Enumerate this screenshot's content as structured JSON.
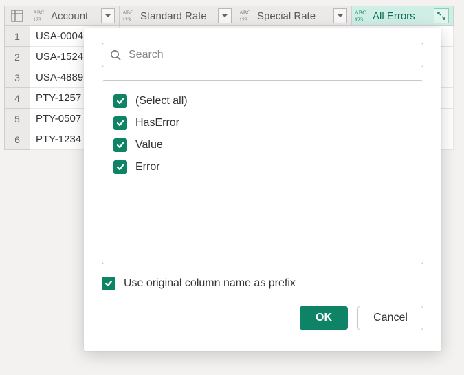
{
  "columns": [
    {
      "label": "Account"
    },
    {
      "label": "Standard Rate"
    },
    {
      "label": "Special Rate"
    },
    {
      "label": "All Errors"
    }
  ],
  "rows": [
    {
      "num": "1",
      "account": "USA-0004"
    },
    {
      "num": "2",
      "account": "USA-1524"
    },
    {
      "num": "3",
      "account": "USA-4889"
    },
    {
      "num": "4",
      "account": "PTY-1257"
    },
    {
      "num": "5",
      "account": "PTY-0507"
    },
    {
      "num": "6",
      "account": "PTY-1234"
    }
  ],
  "panel": {
    "search_placeholder": "Search",
    "options": {
      "select_all": "(Select all)",
      "has_error": "HasError",
      "value": "Value",
      "error": "Error"
    },
    "prefix_label": "Use original column name as prefix",
    "ok_label": "OK",
    "cancel_label": "Cancel"
  }
}
